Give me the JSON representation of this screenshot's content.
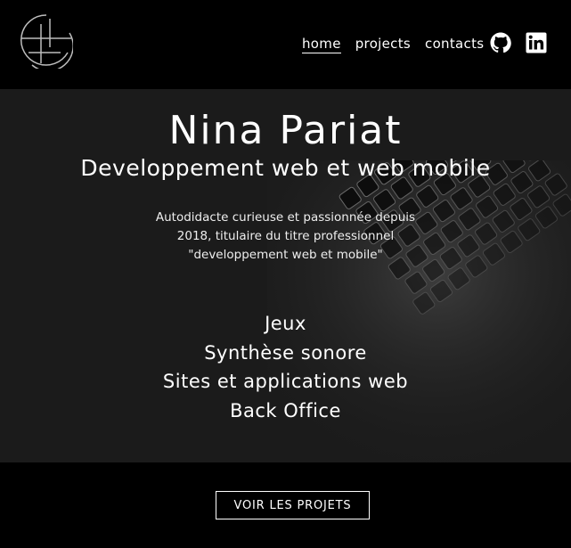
{
  "header": {
    "nav": {
      "home": "home",
      "projects": "projects",
      "contacts": "contacts"
    },
    "social": {
      "github_icon": "github-icon",
      "linkedin_icon": "linkedin-icon"
    }
  },
  "hero": {
    "name": "Nina Pariat",
    "subtitle": "Developpement web et web mobile",
    "bio": "Autodidacte curieuse et passionnée depuis 2018, titulaire du titre professionnel \"developpement web et mobile\"",
    "skills": [
      "Jeux",
      "Synthèse sonore",
      "Sites et applications web",
      "Back Office"
    ]
  },
  "cta": {
    "label": "VOIR LES PROJETS"
  },
  "colors": {
    "background": "#000000",
    "hero_background": "#1b1b1b",
    "text": "#ffffff"
  }
}
